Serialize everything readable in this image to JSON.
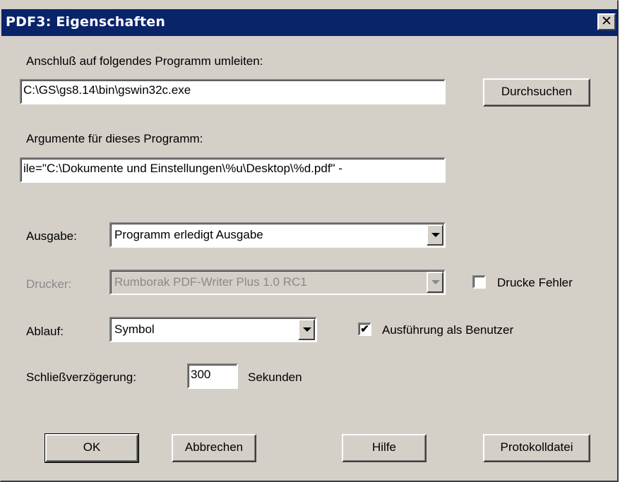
{
  "window": {
    "title": "PDF3: Eigenschaften",
    "close_symbol": "✕"
  },
  "redirect": {
    "label": "Anschluß auf folgendes Programm umleiten:",
    "value": "C:\\GS\\gs8.14\\bin\\gswin32c.exe",
    "browse_label": "Durchsuchen"
  },
  "arguments": {
    "label": "Argumente für dieses Programm:",
    "value": "ile=\"C:\\Dokumente und Einstellungen\\%u\\Desktop\\%d.pdf\" -"
  },
  "output": {
    "label": "Ausgabe:",
    "selected": "Programm erledigt Ausgabe"
  },
  "printer": {
    "label": "Drucker:",
    "selected": "Rumborak PDF-Writer Plus 1.0 RC1",
    "enabled": false
  },
  "print_errors": {
    "label": "Drucke Fehler",
    "checked": false
  },
  "run": {
    "label": "Ablauf:",
    "selected": "Symbol"
  },
  "run_as_user": {
    "label": "Ausführung als Benutzer",
    "checked": true,
    "check_mark": "✔"
  },
  "close_delay": {
    "label": "Schließverzögerung:",
    "value": "300",
    "unit": "Sekunden"
  },
  "buttons": {
    "ok": "OK",
    "cancel": "Abbrechen",
    "help": "Hilfe",
    "logfile": "Protokolldatei"
  }
}
